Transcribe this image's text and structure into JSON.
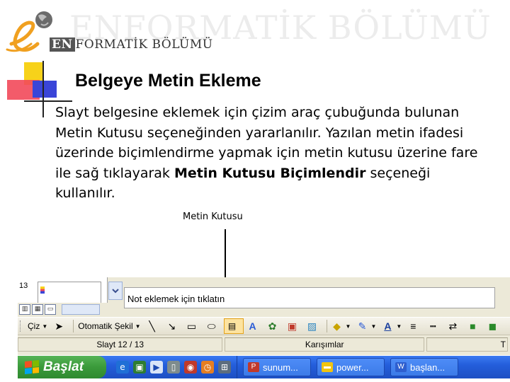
{
  "header": {
    "brand_en": "EN",
    "brand_rest": "FORMATİK BÖLÜMÜ",
    "watermark": "ENFORMATİK BÖLÜMÜ"
  },
  "slide": {
    "title": "Belgeye Metin Ekleme",
    "body_intro": "Slayt belgesine eklemek için çizim araç çubuğunda bulunan Metin Kutusu seçeneğinden yararlanılır. Yazılan metin ifadesi üzerinde biçimlendirme yapmak için metin kutusu üzerine fare ile sağ tıklayarak ",
    "body_bold": "Metin Kutusu Biçimlendir",
    "body_tail": " seçeneği kullanılır.",
    "callout": "Metin Kutusu"
  },
  "ppt": {
    "slide_number": "13",
    "notes_placeholder": "Not eklemek için tıklatın",
    "toolbar": {
      "draw_label": "Çiz",
      "autoshapes_label": "Otomatik Şekil"
    },
    "status": {
      "slide_info": "Slayt 12 / 13",
      "design": "Karışımlar",
      "language": "T"
    }
  },
  "taskbar": {
    "start_label": "Başlat",
    "tasks": [
      "sunum...",
      "power...",
      "başlan..."
    ]
  },
  "colors": {
    "accent_yellow": "#f7d21a",
    "accent_red": "#f2495a",
    "accent_blue": "#3a45d8",
    "taskbar_blue": "#245edb",
    "start_green": "#3a9a3a"
  }
}
